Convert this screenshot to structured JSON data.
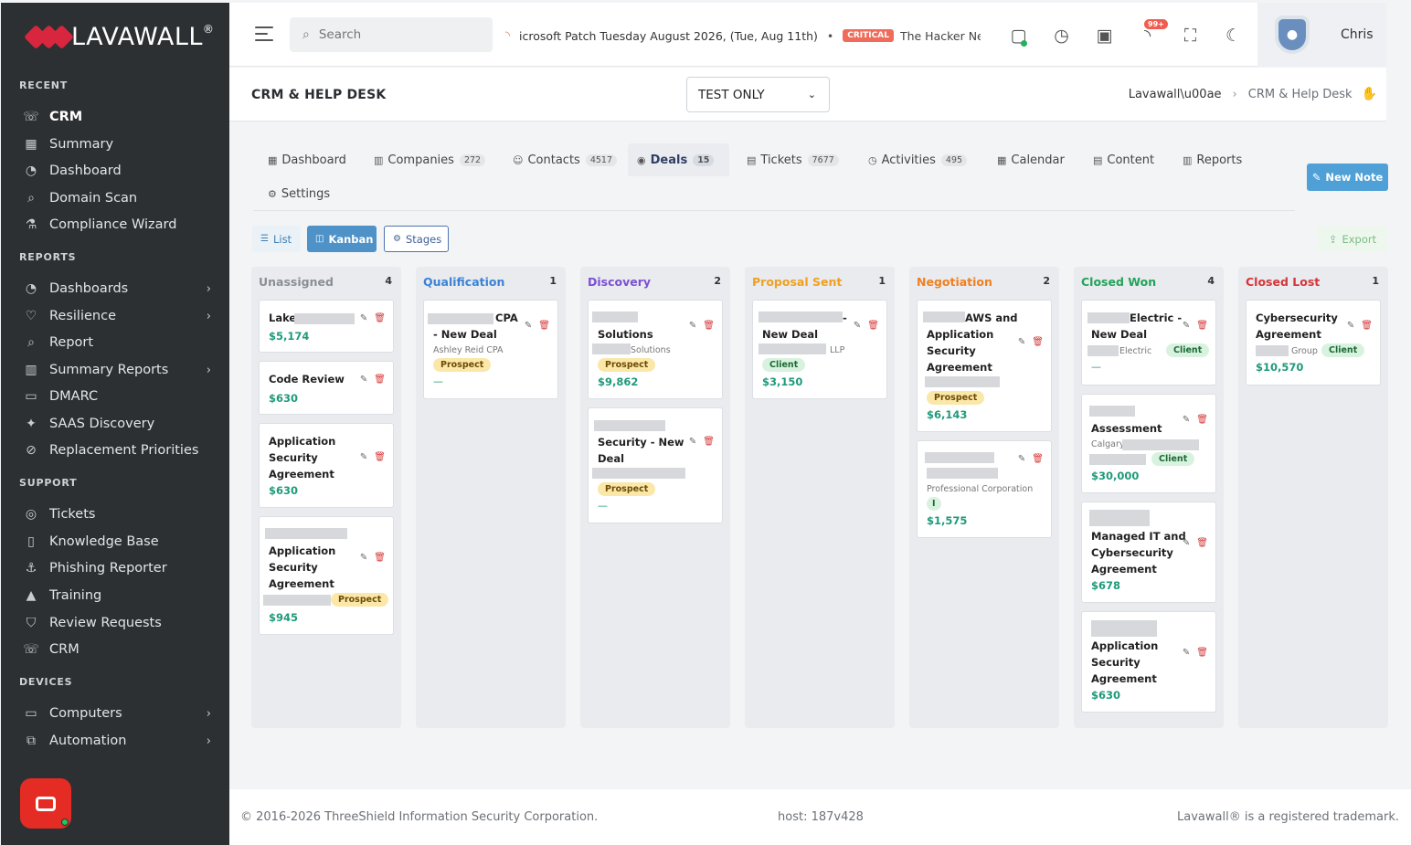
{
  "brand": {
    "name": "LAVAWALL",
    "reg": "®"
  },
  "sidebar": {
    "sections": [
      {
        "title": "RECENT",
        "items": [
          {
            "label": "CRM",
            "icon": "phone-icon",
            "active": true
          },
          {
            "label": "Summary",
            "icon": "grid-icon"
          },
          {
            "label": "Dashboard",
            "icon": "gauge-icon"
          },
          {
            "label": "Domain Scan",
            "icon": "magnify-icon"
          },
          {
            "label": "Compliance Wizard",
            "icon": "flask-icon"
          }
        ]
      },
      {
        "title": "REPORTS",
        "items": [
          {
            "label": "Dashboards",
            "icon": "gauge-icon",
            "chevron": true
          },
          {
            "label": "Resilience",
            "icon": "heart-icon",
            "chevron": true
          },
          {
            "label": "Report",
            "icon": "magnify-icon"
          },
          {
            "label": "Summary Reports",
            "icon": "chart-icon",
            "chevron": true
          },
          {
            "label": "DMARC",
            "icon": "mail-icon"
          },
          {
            "label": "SAAS Discovery",
            "icon": "sparkle-icon"
          },
          {
            "label": "Replacement Priorities",
            "icon": "ban-icon"
          }
        ]
      },
      {
        "title": "SUPPORT",
        "items": [
          {
            "label": "Tickets",
            "icon": "headset-icon"
          },
          {
            "label": "Knowledge Base",
            "icon": "book-icon"
          },
          {
            "label": "Phishing Reporter",
            "icon": "hook-icon"
          },
          {
            "label": "Training",
            "icon": "cap-icon"
          },
          {
            "label": "Review Requests",
            "icon": "shield-check-icon"
          },
          {
            "label": "CRM",
            "icon": "phone-icon"
          }
        ]
      },
      {
        "title": "DEVICES",
        "items": [
          {
            "label": "Computers",
            "icon": "monitor-icon",
            "chevron": true
          },
          {
            "label": "Automation",
            "icon": "automation-icon",
            "chevron": true
          }
        ]
      }
    ]
  },
  "topbar": {
    "search_placeholder": "Search",
    "ticker_text": "icrosoft Patch Tuesday August 2026, (Tue, Aug 11th)",
    "ticker_badge": "CRITICAL",
    "ticker_text2": "The Hacker Ne",
    "notif_badge": "99+",
    "user": "Chris"
  },
  "header": {
    "title": "CRM & HELP DESK",
    "env": "TEST ONLY",
    "breadcrumb_1": "Lavawall\\u00ae",
    "breadcrumb_2": "CRM & Help Desk"
  },
  "tabs": [
    {
      "label": "Dashboard",
      "count": ""
    },
    {
      "label": "Companies",
      "count": "272"
    },
    {
      "label": "Contacts",
      "count": "4517"
    },
    {
      "label": "Deals",
      "count": "15",
      "active": true
    },
    {
      "label": "Tickets",
      "count": "7677"
    },
    {
      "label": "Activities",
      "count": "495"
    },
    {
      "label": "Calendar",
      "count": ""
    },
    {
      "label": "Content",
      "count": ""
    },
    {
      "label": "Reports",
      "count": ""
    },
    {
      "label": "Settings",
      "count": ""
    }
  ],
  "buttons": {
    "new_note": "New Note",
    "list": "List",
    "kanban": "Kanban",
    "stages": "Stages",
    "export": "Export"
  },
  "columns": [
    {
      "name": "Unassigned",
      "count": "4",
      "color": "#8a8f96",
      "cards": [
        {
          "lines": [
            "Lake"
          ],
          "amount": "$5,174"
        },
        {
          "lines": [
            "Code Review"
          ],
          "amount": "$630"
        },
        {
          "lines": [
            "Application",
            "Security",
            "Agreement"
          ],
          "amount": "$630"
        },
        {
          "lines": [
            "Application",
            "Security",
            "Agreement"
          ],
          "badge": "Prospect",
          "amount": "$945"
        }
      ]
    },
    {
      "name": "Qualification",
      "count": "1",
      "color": "#3b82d6",
      "cards": [
        {
          "lines": [
            "CPA",
            "- New Deal"
          ],
          "company": "Ashley Reid CPA",
          "badge": "Prospect",
          "amount": "—"
        }
      ]
    },
    {
      "name": "Discovery",
      "count": "2",
      "color": "#7c4fd4",
      "cards": [
        {
          "lines": [
            "Solutions"
          ],
          "company": "Solutions",
          "badge": "Prospect",
          "amount": "$9,862"
        },
        {
          "lines": [
            "Security - New",
            "Deal"
          ],
          "badge": "Prospect",
          "amount": "—"
        }
      ]
    },
    {
      "name": "Proposal Sent",
      "count": "1",
      "color": "#f0a020",
      "cards": [
        {
          "lines": [
            "-",
            "New Deal"
          ],
          "company": "LLP",
          "badge": "Client",
          "amount": "$3,150"
        }
      ]
    },
    {
      "name": "Negotiation",
      "count": "2",
      "color": "#f08020",
      "cards": [
        {
          "lines": [
            "AWS and",
            "Application",
            "Security",
            "Agreement"
          ],
          "badge": "Prospect",
          "amount": "$6,143"
        },
        {
          "lines": [],
          "company": "Professional Corporation",
          "badge": "I",
          "amount": "$1,575"
        }
      ]
    },
    {
      "name": "Closed Won",
      "count": "4",
      "color": "#22a35a",
      "cards": [
        {
          "lines": [
            "Electric -",
            "New Deal"
          ],
          "company": "Electric",
          "badge": "Client",
          "amount": "—"
        },
        {
          "lines": [
            "Assessment"
          ],
          "company": "Calgary",
          "badge": "Client",
          "amount": "$30,000"
        },
        {
          "lines": [
            "Managed IT and",
            "Cybersecurity",
            "Agreement"
          ],
          "amount": "$678"
        },
        {
          "lines": [
            "Application",
            "Security",
            "Agreement"
          ],
          "amount": "$630"
        }
      ]
    },
    {
      "name": "Closed Lost",
      "count": "1",
      "color": "#d6343a",
      "cards": [
        {
          "lines": [
            "Cybersecurity",
            "Agreement"
          ],
          "company": "Group",
          "badge": "Client",
          "amount": "$10,570"
        }
      ]
    }
  ],
  "footer": {
    "copyright": "© 2016-2026 ThreeShield Information Security Corporation.",
    "host": "host: 187v428",
    "trademark": "Lavawall® is a registered trademark."
  }
}
